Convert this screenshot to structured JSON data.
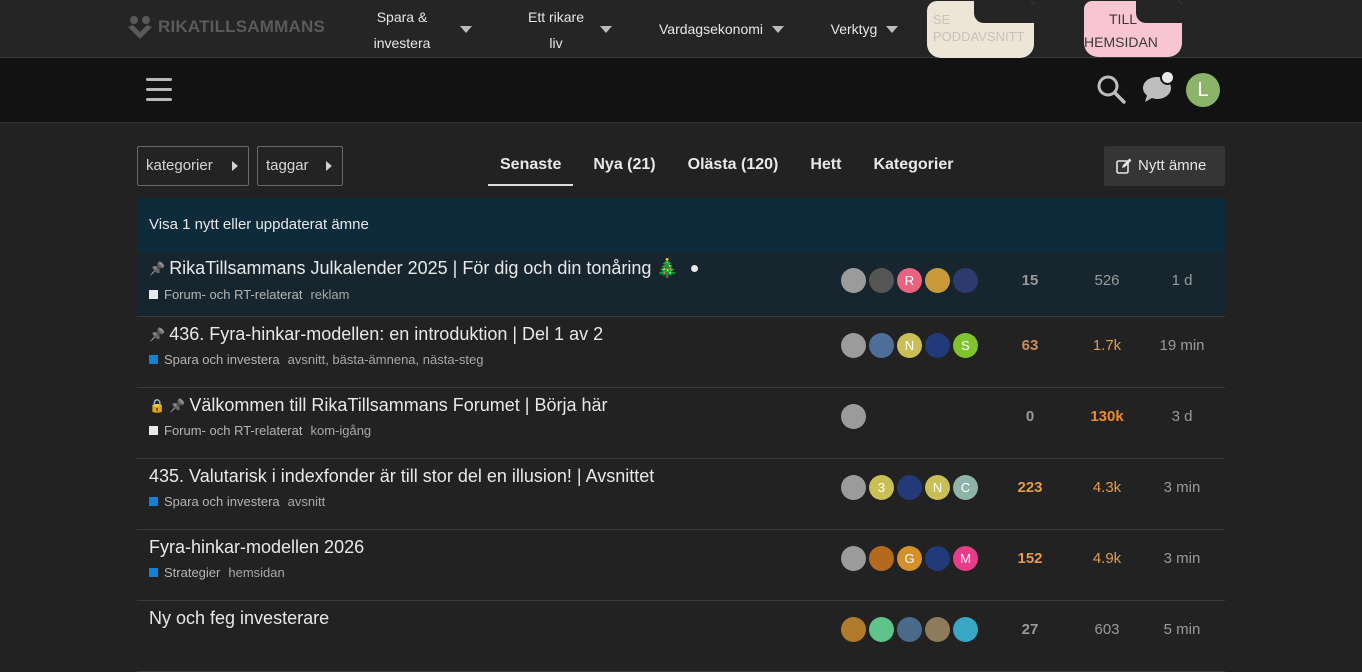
{
  "topnav": {
    "logo_text": "RIKATILLSAMMANS",
    "items": [
      {
        "label_line1": "Spara &",
        "label_line2": "investera"
      },
      {
        "label_line1": "Ett rikare",
        "label_line2": "liv"
      },
      {
        "label": "Vardagsekonomi"
      },
      {
        "label": "Verktyg"
      }
    ],
    "pill_a": {
      "label_line1": "SE",
      "label_line2": "PODDAVSNITT"
    },
    "pill_b": {
      "label_line1": "TILL",
      "label_line2": "HEMSIDAN"
    }
  },
  "header": {
    "user_initial": "L",
    "icons": [
      "hamburger-icon",
      "search-icon",
      "chat-icon"
    ]
  },
  "filters": {
    "categories_label": "kategorier",
    "tags_label": "taggar",
    "new_topic_label": "Nytt ämne"
  },
  "tabs": [
    {
      "label": "Senaste"
    },
    {
      "label": "Nya (21)"
    },
    {
      "label": "Olästa (120)"
    },
    {
      "label": "Hett"
    },
    {
      "label": "Kategorier"
    }
  ],
  "banner": {
    "text": "Visa 1 nytt eller uppdaterat ämne"
  },
  "colors": {
    "accent": "#0e2b3c",
    "category_blue": "#0f82d8",
    "category_white": "#e8e8e8"
  },
  "topics": [
    {
      "title": "RikaTillsammans Julkalender 2025 | För dig och din tonåring 🎄",
      "pinned": true,
      "locked": false,
      "unread_dot": true,
      "category": "Forum- och RT-relaterat",
      "category_color": "#e8e8e8",
      "tags": "reklam",
      "posters": [
        {
          "initial": "",
          "color": "#9b9b9b"
        },
        {
          "initial": "",
          "color": "#555555"
        },
        {
          "initial": "R",
          "color": "#e9637e"
        },
        {
          "initial": "",
          "color": "#c89a3a"
        },
        {
          "initial": "",
          "color": "#2d3a6e"
        }
      ],
      "replies": "15",
      "views": "526",
      "activity": "1 d"
    },
    {
      "title": "436. Fyra-hinkar-modellen: en introduktion | Del 1 av 2",
      "pinned": true,
      "locked": false,
      "unread_dot": false,
      "category": "Spara och investera",
      "category_color": "#0f82d8",
      "tags": "avsnitt, bästa-ämnena, nästa-steg",
      "posters": [
        {
          "initial": "",
          "color": "#9b9b9b"
        },
        {
          "initial": "",
          "color": "#4f6f9a"
        },
        {
          "initial": "N",
          "color": "#c9bf55"
        },
        {
          "initial": "",
          "color": "#233a7a"
        },
        {
          "initial": "S",
          "color": "#7fc42a"
        }
      ],
      "replies": "63",
      "views": "1.7k",
      "activity": "19 min"
    },
    {
      "title": "Välkommen till RikaTillsammans Forumet | Börja här",
      "pinned": true,
      "locked": true,
      "unread_dot": false,
      "category": "Forum- och RT-relaterat",
      "category_color": "#e8e8e8",
      "tags": "kom-igång",
      "posters": [
        {
          "initial": "",
          "color": "#9b9b9b"
        }
      ],
      "replies": "0",
      "views": "130k",
      "activity": "3 d"
    },
    {
      "title": "435. Valutarisk i indexfonder är till stor del en illusion! | Avsnittet",
      "pinned": false,
      "locked": false,
      "unread_dot": false,
      "category": "Spara och investera",
      "category_color": "#0f82d8",
      "tags": "avsnitt",
      "posters": [
        {
          "initial": "",
          "color": "#9b9b9b"
        },
        {
          "initial": "3",
          "color": "#c9bf55"
        },
        {
          "initial": "",
          "color": "#233a7a"
        },
        {
          "initial": "N",
          "color": "#c9bf55"
        },
        {
          "initial": "C",
          "color": "#8fb3a8"
        }
      ],
      "replies": "223",
      "views": "4.3k",
      "activity": "3 min"
    },
    {
      "title": "Fyra-hinkar-modellen 2026",
      "pinned": false,
      "locked": false,
      "unread_dot": false,
      "category": "Strategier",
      "category_color": "#0f82d8",
      "tags": "hemsidan",
      "posters": [
        {
          "initial": "",
          "color": "#9b9b9b"
        },
        {
          "initial": "",
          "color": "#b36a1f"
        },
        {
          "initial": "G",
          "color": "#d4902a"
        },
        {
          "initial": "",
          "color": "#233a7a"
        },
        {
          "initial": "M",
          "color": "#e63c8a"
        }
      ],
      "replies": "152",
      "views": "4.9k",
      "activity": "3 min"
    },
    {
      "title": "Ny och feg investerare",
      "pinned": false,
      "locked": false,
      "unread_dot": false,
      "category": "",
      "category_color": "#0f82d8",
      "tags": "",
      "posters": [
        {
          "initial": "",
          "color": "#b07a2a"
        },
        {
          "initial": "",
          "color": "#5ec48a"
        },
        {
          "initial": "",
          "color": "#4a6a8a"
        },
        {
          "initial": "",
          "color": "#8f7a5a"
        },
        {
          "initial": "",
          "color": "#39a6c6"
        }
      ],
      "replies": "27",
      "views": "603",
      "activity": "5 min"
    }
  ]
}
